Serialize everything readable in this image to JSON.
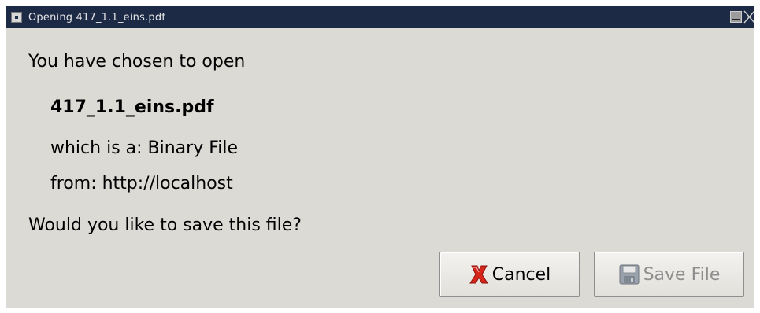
{
  "window": {
    "title": "Opening 417_1.1_eins.pdf"
  },
  "dialog": {
    "intro": "You have chosen to open",
    "filename": "417_1.1_eins.pdf",
    "type_line": "which is a: Binary File",
    "from_line": "from: http://localhost",
    "question": "Would you like to save this file?"
  },
  "buttons": {
    "cancel_label": "Cancel",
    "cancel_icon": "cancel-x-icon",
    "save_label": "Save File",
    "save_icon": "floppy-disk-icon",
    "save_enabled": false
  },
  "colors": {
    "titlebar_bg": "#1c2a45",
    "dialog_bg": "#dcdad5",
    "cancel_icon_red": "#d9261c",
    "disabled_text": "#8e8e8e"
  }
}
